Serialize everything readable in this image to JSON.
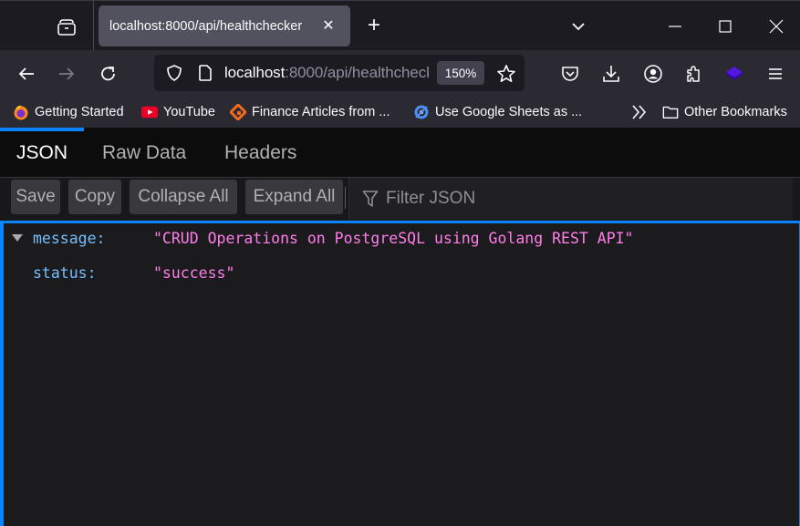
{
  "browser": {
    "tab": {
      "title": "localhost:8000/api/healthchecker"
    },
    "url": {
      "host": "localhost",
      "rest": ":8000/api/healthchecker"
    },
    "zoom_level": "150%",
    "bookmarks": [
      {
        "label": "Getting Started",
        "icon": "firefox-icon"
      },
      {
        "label": "YouTube",
        "icon": "youtube-icon"
      },
      {
        "label": "Finance Articles from ...",
        "icon": "finance-site-icon"
      },
      {
        "label": "Use Google Sheets as ...",
        "icon": "google-sheets-site-icon"
      }
    ],
    "other_bookmarks": "Other Bookmarks"
  },
  "viewer": {
    "tabs": [
      {
        "label": "JSON",
        "active": true
      },
      {
        "label": "Raw Data",
        "active": false
      },
      {
        "label": "Headers",
        "active": false
      }
    ],
    "toolbar": {
      "save": "Save",
      "copy": "Copy",
      "collapse_all": "Collapse All",
      "expand_all": "Expand All",
      "filter_placeholder": "Filter JSON"
    },
    "json": [
      {
        "key": "message:",
        "value": "\"CRUD Operations on PostgreSQL using Golang REST API\""
      },
      {
        "key": "status:",
        "value": "\"success\""
      }
    ]
  },
  "colors": {
    "accent": "#0a84ff",
    "json_key": "#75bfff",
    "json_string": "#ff7de9"
  }
}
